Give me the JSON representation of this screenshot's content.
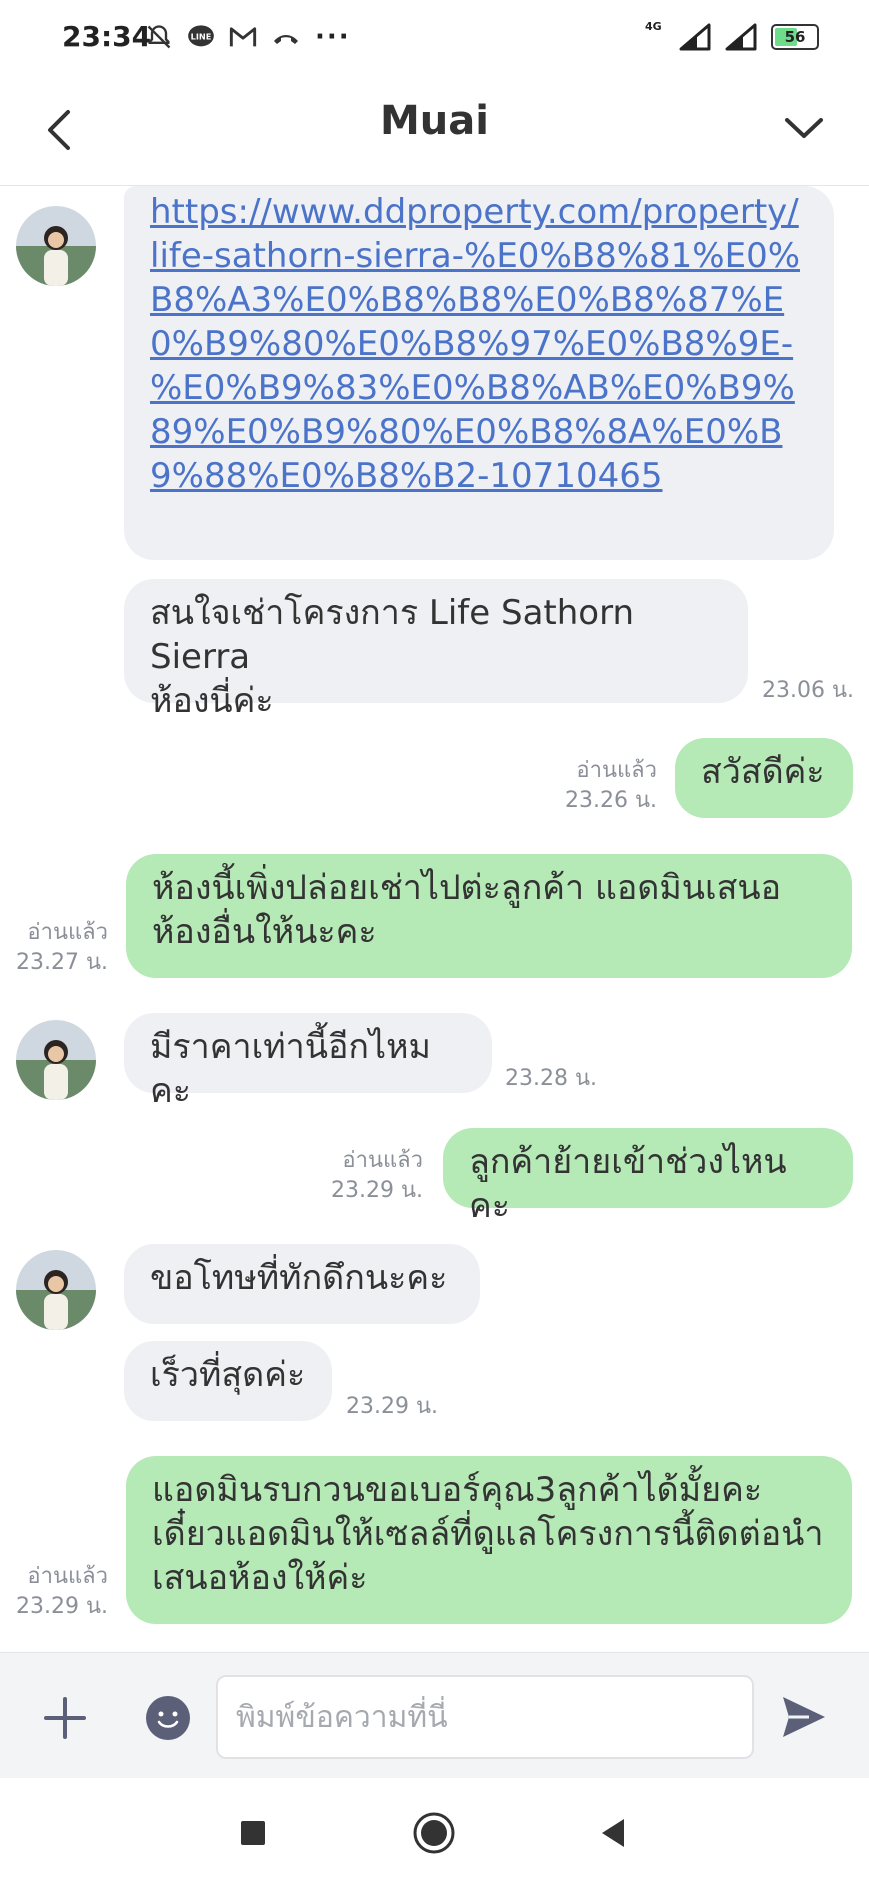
{
  "status_bar": {
    "time": "23:34",
    "more": "···",
    "network": "4G",
    "battery": "56"
  },
  "header": {
    "title": "Muai"
  },
  "messages": {
    "m1_link": "https://www.ddproperty.com/property/life-sathorn-sierra-%E0%B8%81%E0%B8%A3%E0%B8%B8%E0%B8%87%E0%B9%80%E0%B8%97%E0%B8%9E-%E0%B9%83%E0%B8%AB%E0%B9%89%E0%B9%80%E0%B8%8A%E0%B9%88%E0%B8%B2-10710465",
    "m2_line1": "สนใจเช่าโครงการ Life Sathorn Sierra",
    "m2_line2": "ห้องนี่ค่ะ",
    "m2_time": "23.06 น.",
    "m3_text": "สวัสดีค่ะ",
    "m3_read": "อ่านแล้ว",
    "m3_time": "23.26 น.",
    "m4_line1": "ห้องนี้เพิ่งปล่อยเช่าไปต่ะลูกค้า แอดมินเสนอ",
    "m4_line2": "ห้องอื่นให้นะคะ",
    "m4_read": "อ่านแล้ว",
    "m4_time": "23.27 น.",
    "m5_text": "มีราคาเท่านี้อีกไหมคะ",
    "m5_time": "23.28 น.",
    "m6_text": "ลูกค้าย้ายเข้าช่วงไหนคะ",
    "m6_read": "อ่านแล้ว",
    "m6_time": "23.29 น.",
    "m7_text": "ขอโทษที่ทักดึกนะคะ",
    "m8_text": "เร็วที่สุดค่ะ",
    "m8_time": "23.29 น.",
    "m9_line1": "แอดมินรบกวนขอเบอร์คุณ3ลูกค้าได้มั้ยคะ",
    "m9_line2": "เดี๋ยวแอดมินให้เซลล์ที่ดูแลโครงการนี้ติดต่อนำ",
    "m9_line3": "เสนอห้องให้ค่ะ",
    "m9_read": "อ่านแล้ว",
    "m9_time": "23.29 น."
  },
  "input": {
    "placeholder": "พิมพ์ข้อความที่นี่"
  },
  "colors": {
    "incoming_bubble": "#eef0f3",
    "outgoing_bubble": "#b5e9b6",
    "link": "#4a73c9",
    "icon": "#5b6078"
  }
}
